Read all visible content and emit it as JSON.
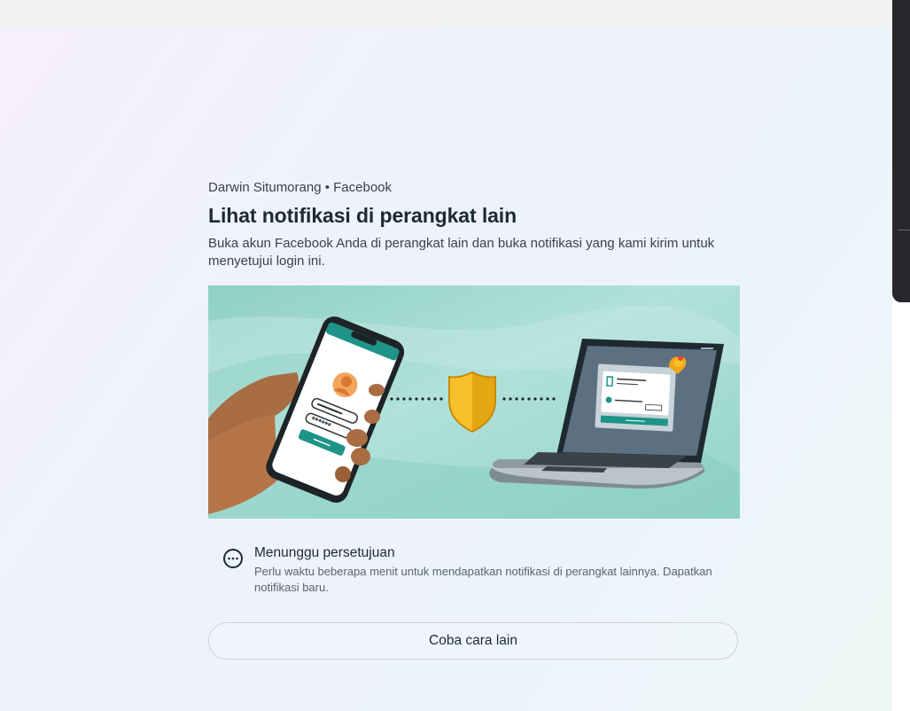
{
  "login": {
    "account_line": "Darwin Situmorang • Facebook",
    "title": "Lihat notifikasi di perangkat lain",
    "description": "Buka akun Facebook Anda di perangkat lain dan buka notifikasi yang kami kirim untuk menyetujui login ini.",
    "status": {
      "icon": "more-horizontal-circle-icon",
      "title": "Menunggu persetujuan",
      "description": "Perlu waktu beberapa menit untuk mendapatkan notifikasi di perangkat lainnya. Dapatkan notifikasi baru."
    },
    "alt_button_label": "Coba cara lain",
    "illustration_password_mask": "******"
  },
  "colors": {
    "primary_text": "#1c2b33",
    "secondary_text": "#3b4249",
    "teal_accent": "#1e9488",
    "shield_gold": "#f2b31b",
    "illustration_bg": "#9fd8cf"
  }
}
